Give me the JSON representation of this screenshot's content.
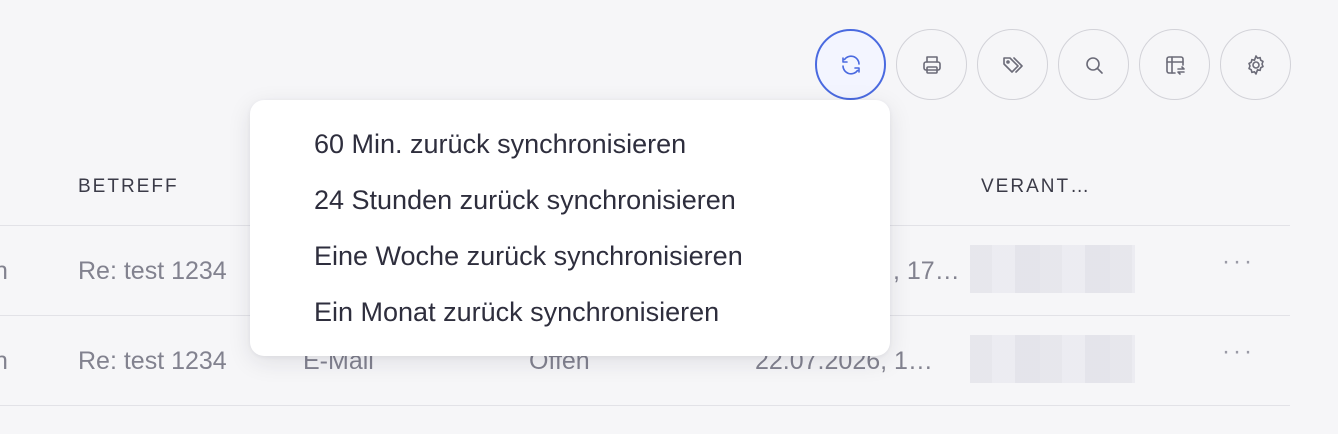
{
  "toolbar": {
    "buttons": [
      {
        "name": "sync",
        "icon": "refresh-icon",
        "active": true
      },
      {
        "name": "print",
        "icon": "printer-icon"
      },
      {
        "name": "tags",
        "icon": "tags-icon"
      },
      {
        "name": "search",
        "icon": "search-icon"
      },
      {
        "name": "columns",
        "icon": "table-swap-icon"
      },
      {
        "name": "settings",
        "icon": "gear-icon"
      }
    ]
  },
  "table": {
    "headers": {
      "subject": "BETREFF",
      "assignee": "VERANT…"
    },
    "rows": [
      {
        "left_fragment": "n",
        "subject": "Re: test 1234",
        "channel": "",
        "status": "",
        "date": "…, 17…"
      },
      {
        "left_fragment": "n",
        "subject": "Re: test 1234",
        "channel": "E-Mail",
        "status": "Offen",
        "date": "22.07.2026, 1…"
      }
    ],
    "row_actions": "···"
  },
  "sync_menu": {
    "items": [
      "60 Min. zurück synchronisieren",
      "24 Stunden zurück synchronisieren",
      "Eine Woche zurück synchronisieren",
      "Ein Monat zurück synchronisieren"
    ]
  },
  "colors": {
    "accent": "#4a6ae0",
    "background": "#f6f6f8"
  }
}
